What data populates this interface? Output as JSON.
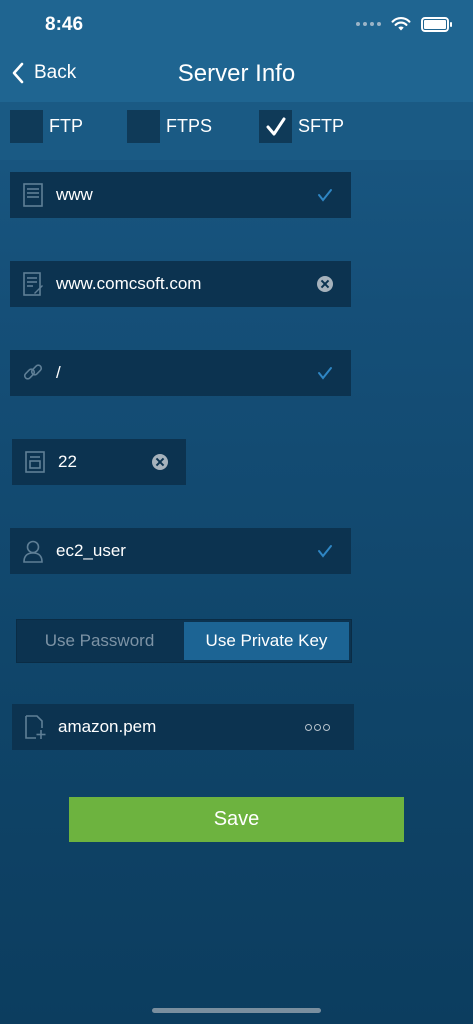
{
  "status": {
    "time": "8:46"
  },
  "nav": {
    "back_label": "Back",
    "title": "Server Info"
  },
  "protocols": [
    {
      "label": "FTP",
      "checked": false
    },
    {
      "label": "FTPS",
      "checked": false
    },
    {
      "label": "SFTP",
      "checked": true
    }
  ],
  "fields": {
    "name": {
      "value": "www",
      "icon": "server-icon",
      "action": "checkmark"
    },
    "host": {
      "value": "www.comcsoft.com",
      "icon": "host-document-icon",
      "action": "clear"
    },
    "path": {
      "value": "/",
      "icon": "link-icon",
      "action": "checkmark"
    },
    "port": {
      "value": "22",
      "icon": "port-icon",
      "action": "clear"
    },
    "user": {
      "value": "ec2_user",
      "icon": "user-icon",
      "action": "checkmark"
    }
  },
  "auth": {
    "options": [
      "Use Password",
      "Use Private Key"
    ],
    "selected": "Use Private Key"
  },
  "key_file": {
    "value": "amazon.pem",
    "icon": "add-file-icon"
  },
  "save_label": "Save",
  "colors": {
    "accent": "#1c6494",
    "save": "#6db33f",
    "field_bg": "#0c3350",
    "check": "#2f86c4"
  }
}
